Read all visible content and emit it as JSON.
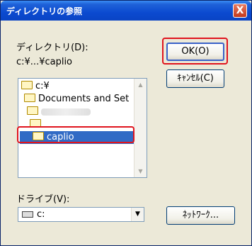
{
  "window": {
    "title": "ディレクトリの参照",
    "close_label": "X"
  },
  "directory": {
    "label": "ディレクトリ(D):",
    "current_path": "c:¥...¥caplio"
  },
  "tree": [
    {
      "label": "c:¥",
      "indent": 0
    },
    {
      "label": "Documents and Set",
      "indent": 1
    },
    {
      "label": "",
      "indent": 2,
      "blurred": true
    },
    {
      "label": "",
      "indent": 3
    },
    {
      "label": "caplio",
      "indent": 4,
      "selected": true
    }
  ],
  "buttons": {
    "ok": "OK(O)",
    "cancel": "ｷｬﾝｾﾙ(C)",
    "network": "ﾈｯﾄﾜｰｸ..."
  },
  "drive": {
    "label": "ドライブ(V):",
    "value": "c:"
  },
  "colors": {
    "highlight": "#e0141e",
    "selection": "#316ac5",
    "titlebar": "#0b4ad0"
  }
}
